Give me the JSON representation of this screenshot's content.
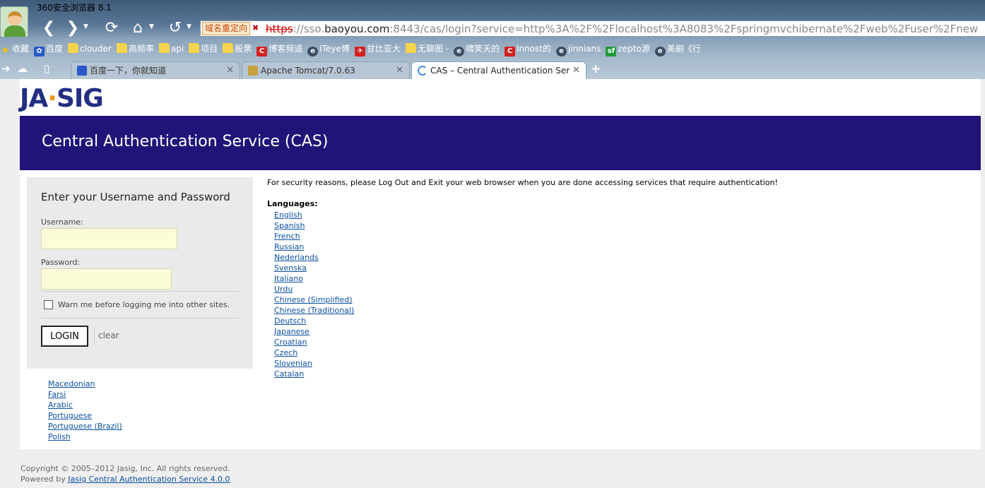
{
  "browser": {
    "title": "360安全浏览器 8.1",
    "redirect_badge": "域名重定向",
    "url": {
      "protocol": "https",
      "rest_prefix": "://sso.",
      "host": "baoyou.com",
      "path": ":8443/cas/login?service=http%3A%2F%2Flocalhost%3A8083%2Fspringmvchibernate%2Fweb%2Fuser%2Fnew"
    },
    "bookmarks": [
      {
        "label": "收藏",
        "icon": "star-icon"
      },
      {
        "label": "百度",
        "icon": "paw-icon"
      },
      {
        "label": "clouder",
        "icon": "folder-icon"
      },
      {
        "label": "高频率",
        "icon": "folder-icon"
      },
      {
        "label": "api",
        "icon": "folder-icon"
      },
      {
        "label": "项目",
        "icon": "folder-icon"
      },
      {
        "label": "股票",
        "icon": "folder-icon"
      },
      {
        "label": "博客频道",
        "icon": "csdn-icon"
      },
      {
        "label": "ITeye博",
        "icon": "globe-icon"
      },
      {
        "label": "甘比亚大",
        "icon": "flag-icon"
      },
      {
        "label": "无聊图 -",
        "icon": "image-icon"
      },
      {
        "label": "啸笑天的",
        "icon": "globe-icon"
      },
      {
        "label": "lnnost的",
        "icon": "csdn-icon"
      },
      {
        "label": "jinnians",
        "icon": "globe-icon"
      },
      {
        "label": "zepto源",
        "icon": "sf-icon"
      },
      {
        "label": "美剧《行",
        "icon": "globe-icon"
      }
    ],
    "tabs": [
      {
        "label": "百度一下，你就知道",
        "icon": "paw-icon"
      },
      {
        "label": "Apache Tomcat/7.0.63",
        "icon": "tomcat-icon"
      },
      {
        "label": "CAS – Central Authentication Ser",
        "icon": "loading-icon"
      }
    ]
  },
  "page": {
    "logo": {
      "left": "JA",
      "dot": "·",
      "right": "SIG"
    },
    "banner_title": "Central Authentication Service (CAS)",
    "login": {
      "heading": "Enter your Username and Password",
      "username_label": "Username:",
      "username_value": "",
      "password_label": "Password:",
      "password_value": "",
      "warn_label": "Warn me before logging me into other sites.",
      "login_button": "LOGIN",
      "clear_button": "clear"
    },
    "security_notice": "For security reasons, please Log Out and Exit your web browser when you are done accessing services that require authentication!",
    "languages_title": "Languages:",
    "languages": [
      "English",
      "Spanish",
      "French",
      "Russian",
      "Nederlands",
      "Svenska",
      "Italiano",
      "Urdu",
      "Chinese (Simplified)",
      "Chinese (Traditional)",
      "Deutsch",
      "Japanese",
      "Croatian",
      "Czech",
      "Slovenian",
      "Catalan"
    ],
    "languages_more": [
      "Macedonian",
      "Farsi",
      "Arabic",
      "Portuguese",
      "Portuguese (Brazil)",
      "Polish"
    ],
    "footer": {
      "copyright": "Copyright © 2005–2012 Jasig, Inc. All rights reserved.",
      "powered_prefix": "Powered by",
      "powered_link": "Jasig Central Authentication Service 4.0.0"
    }
  },
  "colors": {
    "banner": "#211479",
    "logo": "#222e82",
    "link": "#0a4fa0",
    "input_bg": "#fdfcd9"
  }
}
